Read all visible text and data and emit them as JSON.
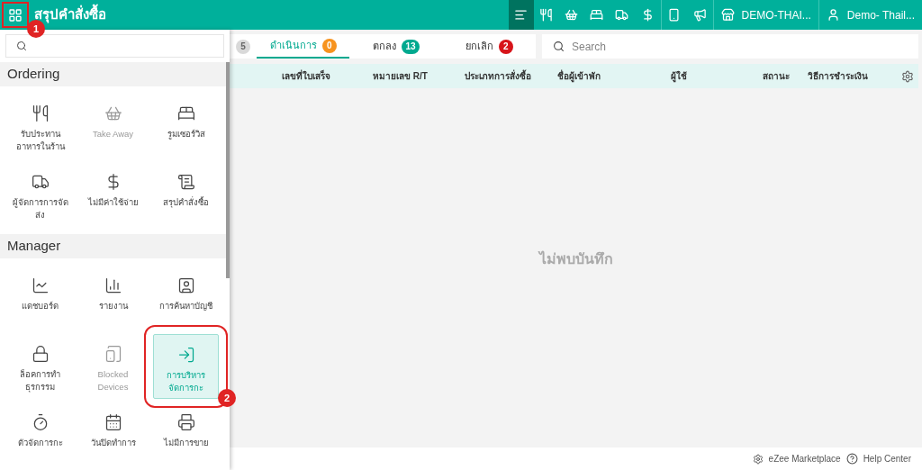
{
  "topbar": {
    "title": "สรุปคำสั่งซื้อ",
    "tools": [
      {
        "selected": true
      },
      {
        "selected": false
      },
      {
        "selected": false
      },
      {
        "selected": false
      },
      {
        "selected": false
      },
      {
        "selected": false
      },
      {
        "selected": false
      },
      {
        "selected": false
      }
    ],
    "property": "DEMO-THAI...",
    "user": "Demo- Thail..."
  },
  "menu": {
    "sections": [
      {
        "title": "Ordering",
        "items": [
          {
            "label": "รับประทานอาหารในร้าน",
            "disabled": false,
            "selected": false
          },
          {
            "label": "Take Away",
            "disabled": true,
            "selected": false
          },
          {
            "label": "รูมเซอร์วิส",
            "disabled": false,
            "selected": false
          },
          {
            "label": "ผู้จัดการการจัดส่ง",
            "disabled": false,
            "selected": false
          },
          {
            "label": "ไม่มีค่าใช้จ่าย",
            "disabled": false,
            "selected": false
          },
          {
            "label": "สรุปคำสั่งซื้อ",
            "disabled": false,
            "selected": false
          }
        ]
      },
      {
        "title": "Manager",
        "items": [
          {
            "label": "แดชบอร์ด",
            "disabled": false,
            "selected": false
          },
          {
            "label": "รายงาน",
            "disabled": false,
            "selected": false
          },
          {
            "label": "การค้นหาบัญชี",
            "disabled": false,
            "selected": false
          },
          {
            "label": "ล็อคการทำธุรกรรม",
            "disabled": false,
            "selected": false
          },
          {
            "label": "Blocked Devices",
            "disabled": true,
            "selected": false
          },
          {
            "label": "การบริหารจัดการกะ",
            "disabled": false,
            "selected": true
          },
          {
            "label": "ตัวจัดการกะ",
            "disabled": false,
            "selected": false
          },
          {
            "label": "วันปิดทำการ",
            "disabled": false,
            "selected": false
          },
          {
            "label": "ไม่มีการขาย",
            "disabled": false,
            "selected": false
          }
        ]
      }
    ]
  },
  "tabs": [
    {
      "badge": "5",
      "color": "#d9d9d9",
      "selected": false
    },
    {
      "label": "ดำเนินการ",
      "badge": "0",
      "color": "#f7931e",
      "selected": true
    },
    {
      "label": "ตกลง",
      "badge": "13",
      "color": "#00a98f",
      "selected": false
    },
    {
      "label": "ยกเลิก",
      "badge": "2",
      "color": "#d7141a",
      "selected": false
    }
  ],
  "search": {
    "placeholder": "Search"
  },
  "table": {
    "columns": [
      "เลขที่ใบเสร็จ",
      "หมายเลข R/T",
      "ประเภทการสั่งซื้อ",
      "ชื่อผู้เข้าพัก",
      "ผู้ใช้",
      "สถานะ",
      "วิธีการชำระเงิน"
    ],
    "empty": "ไม่พบบันทึก"
  },
  "footer": {
    "links": [
      "eZee Marketplace",
      "Help Center"
    ]
  },
  "annotations": [
    "1",
    "2"
  ]
}
